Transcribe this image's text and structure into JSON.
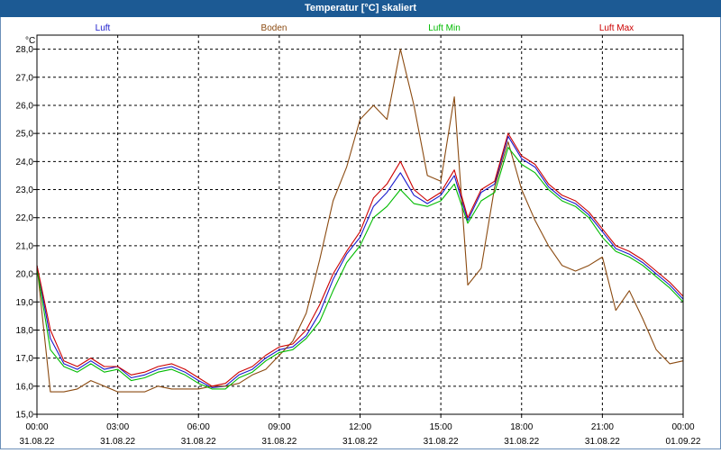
{
  "chart_data": {
    "type": "line",
    "title": "Temperatur [°C] skaliert",
    "ylabel": "°C",
    "ylim": [
      15.0,
      28.5
    ],
    "yticks": [
      "15,0",
      "16,0",
      "17,0",
      "18,0",
      "19,0",
      "20,0",
      "21,0",
      "22,0",
      "23,0",
      "24,0",
      "25,0",
      "26,0",
      "27,0",
      "28,0"
    ],
    "xticks": [
      {
        "time": "00:00",
        "date": "31.08.22"
      },
      {
        "time": "03:00",
        "date": "31.08.22"
      },
      {
        "time": "06:00",
        "date": "31.08.22"
      },
      {
        "time": "09:00",
        "date": "31.08.22"
      },
      {
        "time": "12:00",
        "date": "31.08.22"
      },
      {
        "time": "15:00",
        "date": "31.08.22"
      },
      {
        "time": "18:00",
        "date": "31.08.22"
      },
      {
        "time": "21:00",
        "date": "31.08.22"
      },
      {
        "time": "00:00",
        "date": "01.09.22"
      }
    ],
    "xrange_hours": [
      0,
      24
    ],
    "grid": true,
    "legend_placement": "top",
    "x_hours": [
      0,
      0.5,
      1,
      1.5,
      2,
      2.5,
      3,
      3.5,
      4,
      4.5,
      5,
      5.5,
      6,
      6.5,
      7,
      7.5,
      8,
      8.5,
      9,
      9.5,
      10,
      10.5,
      11,
      11.5,
      12,
      12.5,
      13,
      13.5,
      14,
      14.5,
      15,
      15.5,
      16,
      16.5,
      17,
      17.5,
      18,
      18.5,
      19,
      19.5,
      20,
      20.5,
      21,
      21.5,
      22,
      22.5,
      23,
      23.5,
      24
    ],
    "series": [
      {
        "name": "Luft",
        "color": "#1a1acc",
        "values": [
          20.3,
          17.7,
          16.8,
          16.6,
          16.9,
          16.6,
          16.7,
          16.3,
          16.4,
          16.6,
          16.7,
          16.5,
          16.2,
          15.95,
          16.0,
          16.4,
          16.6,
          17.0,
          17.3,
          17.4,
          17.8,
          18.6,
          19.8,
          20.7,
          21.3,
          22.4,
          22.9,
          23.6,
          22.8,
          22.5,
          22.8,
          23.5,
          21.9,
          22.9,
          23.2,
          24.9,
          24.1,
          23.8,
          23.1,
          22.7,
          22.5,
          22.1,
          21.5,
          20.9,
          20.7,
          20.4,
          20.0,
          19.6,
          19.1
        ]
      },
      {
        "name": "Boden",
        "color": "#8b4a10",
        "values": [
          20.3,
          15.8,
          15.8,
          15.9,
          16.2,
          16.0,
          15.8,
          15.8,
          15.8,
          16.0,
          15.9,
          15.9,
          15.9,
          16.0,
          16.0,
          16.1,
          16.4,
          16.6,
          17.1,
          17.6,
          18.6,
          20.5,
          22.6,
          23.8,
          25.5,
          26.0,
          25.5,
          28.0,
          26.0,
          23.5,
          23.3,
          26.3,
          19.6,
          20.2,
          23.1,
          24.7,
          23.0,
          21.9,
          21.0,
          20.3,
          20.1,
          20.3,
          20.6,
          18.7,
          19.4,
          18.4,
          17.3,
          16.8,
          16.9
        ]
      },
      {
        "name": "Luft Min",
        "color": "#00bb00",
        "values": [
          20.2,
          17.3,
          16.7,
          16.5,
          16.8,
          16.5,
          16.6,
          16.2,
          16.3,
          16.5,
          16.6,
          16.4,
          16.1,
          15.9,
          15.9,
          16.3,
          16.5,
          16.9,
          17.2,
          17.3,
          17.7,
          18.3,
          19.4,
          20.4,
          21.0,
          22.0,
          22.4,
          23.0,
          22.5,
          22.4,
          22.6,
          23.2,
          21.8,
          22.6,
          22.9,
          24.5,
          23.9,
          23.6,
          23.0,
          22.6,
          22.4,
          22.0,
          21.3,
          20.8,
          20.6,
          20.3,
          19.9,
          19.5,
          19.0
        ]
      },
      {
        "name": "Luft Max",
        "color": "#cc0000",
        "values": [
          20.3,
          18.0,
          16.9,
          16.7,
          17.0,
          16.7,
          16.7,
          16.4,
          16.5,
          16.7,
          16.8,
          16.6,
          16.3,
          16.0,
          16.1,
          16.5,
          16.7,
          17.1,
          17.4,
          17.5,
          18.0,
          18.9,
          20.0,
          20.8,
          21.5,
          22.7,
          23.2,
          24.0,
          23.0,
          22.6,
          22.9,
          23.7,
          22.0,
          23.0,
          23.3,
          25.0,
          24.2,
          23.9,
          23.2,
          22.8,
          22.6,
          22.2,
          21.6,
          21.0,
          20.8,
          20.5,
          20.1,
          19.7,
          19.2
        ]
      }
    ]
  }
}
